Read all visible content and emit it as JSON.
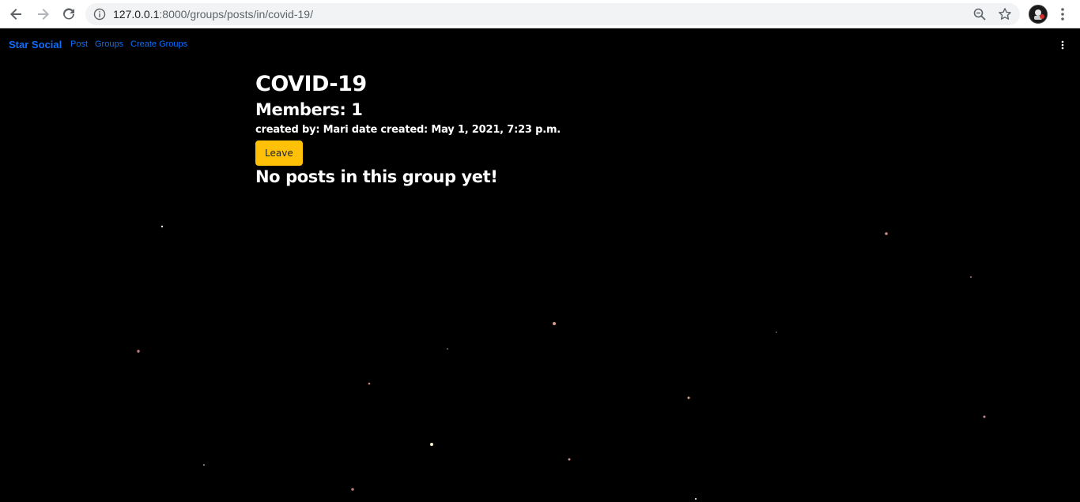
{
  "browser": {
    "url_host": "127.0.0.1",
    "url_path": ":8000/groups/posts/in/covid-19/",
    "icons": [
      "back-arrow-icon",
      "forward-arrow-icon",
      "reload-icon",
      "info-icon",
      "zoom-icon",
      "star-icon",
      "profile-avatar",
      "chrome-menu-icon"
    ]
  },
  "navbar": {
    "brand": "Star Social",
    "links": [
      {
        "label": "Post"
      },
      {
        "label": "Groups"
      },
      {
        "label": "Create Groups"
      }
    ],
    "accent_color": "#0d6efd"
  },
  "group": {
    "title": "COVID-19",
    "members": "Members: 1",
    "created_line": "created by: Mari date created: May 1, 2021, 7:23 p.m.",
    "leave_label": "Leave",
    "leave_color": "#ffc107",
    "empty_message": "No posts in this group yet!"
  },
  "colors": {
    "background": "#000000",
    "text": "#ffffff"
  }
}
